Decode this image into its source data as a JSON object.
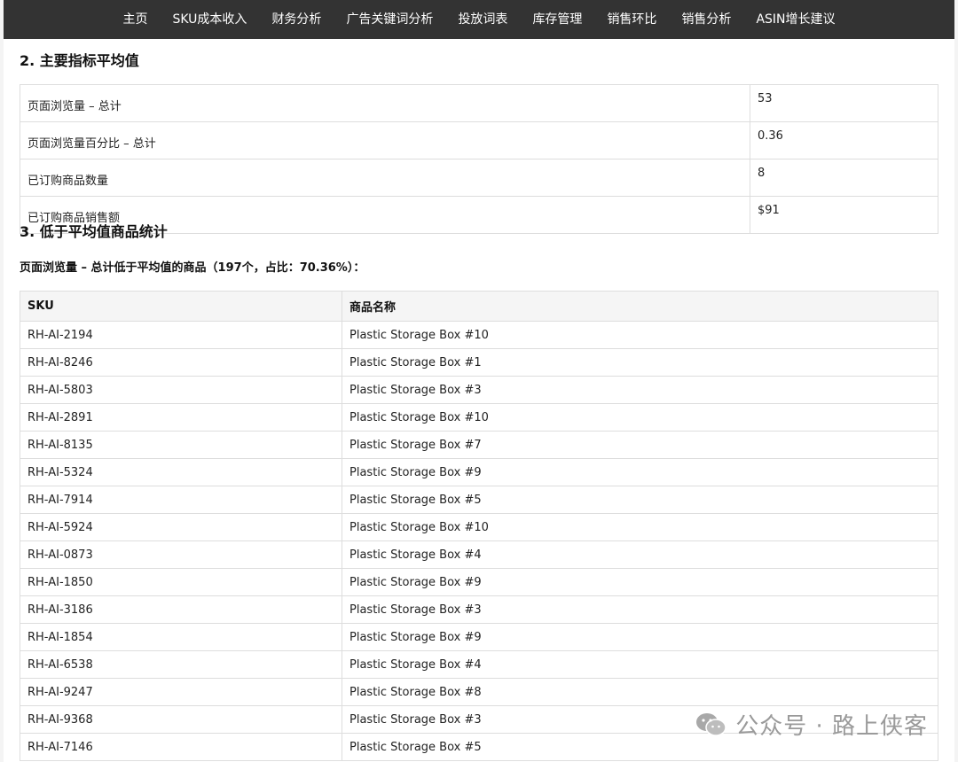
{
  "nav": {
    "items": [
      "主页",
      "SKU成本收入",
      "财务分析",
      "广告关键词分析",
      "投放词表",
      "库存管理",
      "销售环比",
      "销售分析",
      "ASIN增长建议"
    ]
  },
  "section2": {
    "title": "2. 主要指标平均值",
    "metrics": [
      {
        "label": "页面浏览量 – 总计",
        "value": "53"
      },
      {
        "label": "页面浏览量百分比 – 总计",
        "value": "0.36"
      },
      {
        "label": "已订购商品数量",
        "value": "8"
      },
      {
        "label": "已订购商品销售额",
        "value": "$91"
      }
    ]
  },
  "section3": {
    "title": "3. 低于平均值商品统计",
    "subtitle": "页面浏览量 – 总计低于平均值的商品（197个，占比：70.36%）：",
    "headers": [
      "SKU",
      "商品名称"
    ],
    "rows": [
      {
        "sku": "RH-AI-2194",
        "name": "Plastic Storage Box #10"
      },
      {
        "sku": "RH-AI-8246",
        "name": "Plastic Storage Box #1"
      },
      {
        "sku": "RH-AI-5803",
        "name": "Plastic Storage Box #3"
      },
      {
        "sku": "RH-AI-2891",
        "name": "Plastic Storage Box #10"
      },
      {
        "sku": "RH-AI-8135",
        "name": "Plastic Storage Box #7"
      },
      {
        "sku": "RH-AI-5324",
        "name": "Plastic Storage Box #9"
      },
      {
        "sku": "RH-AI-7914",
        "name": "Plastic Storage Box #5"
      },
      {
        "sku": "RH-AI-5924",
        "name": "Plastic Storage Box #10"
      },
      {
        "sku": "RH-AI-0873",
        "name": "Plastic Storage Box #4"
      },
      {
        "sku": "RH-AI-1850",
        "name": "Plastic Storage Box #9"
      },
      {
        "sku": "RH-AI-3186",
        "name": "Plastic Storage Box #3"
      },
      {
        "sku": "RH-AI-1854",
        "name": "Plastic Storage Box #9"
      },
      {
        "sku": "RH-AI-6538",
        "name": "Plastic Storage Box #4"
      },
      {
        "sku": "RH-AI-9247",
        "name": "Plastic Storage Box #8"
      },
      {
        "sku": "RH-AI-9368",
        "name": "Plastic Storage Box #3"
      },
      {
        "sku": "RH-AI-7146",
        "name": "Plastic Storage Box #5"
      }
    ]
  },
  "watermark": {
    "text": "公众号 · 路上侠客",
    "icon": "wechat-icon"
  },
  "colors": {
    "navbar": "#333333",
    "border": "#dddddd",
    "header_bg": "#f5f5f5"
  }
}
